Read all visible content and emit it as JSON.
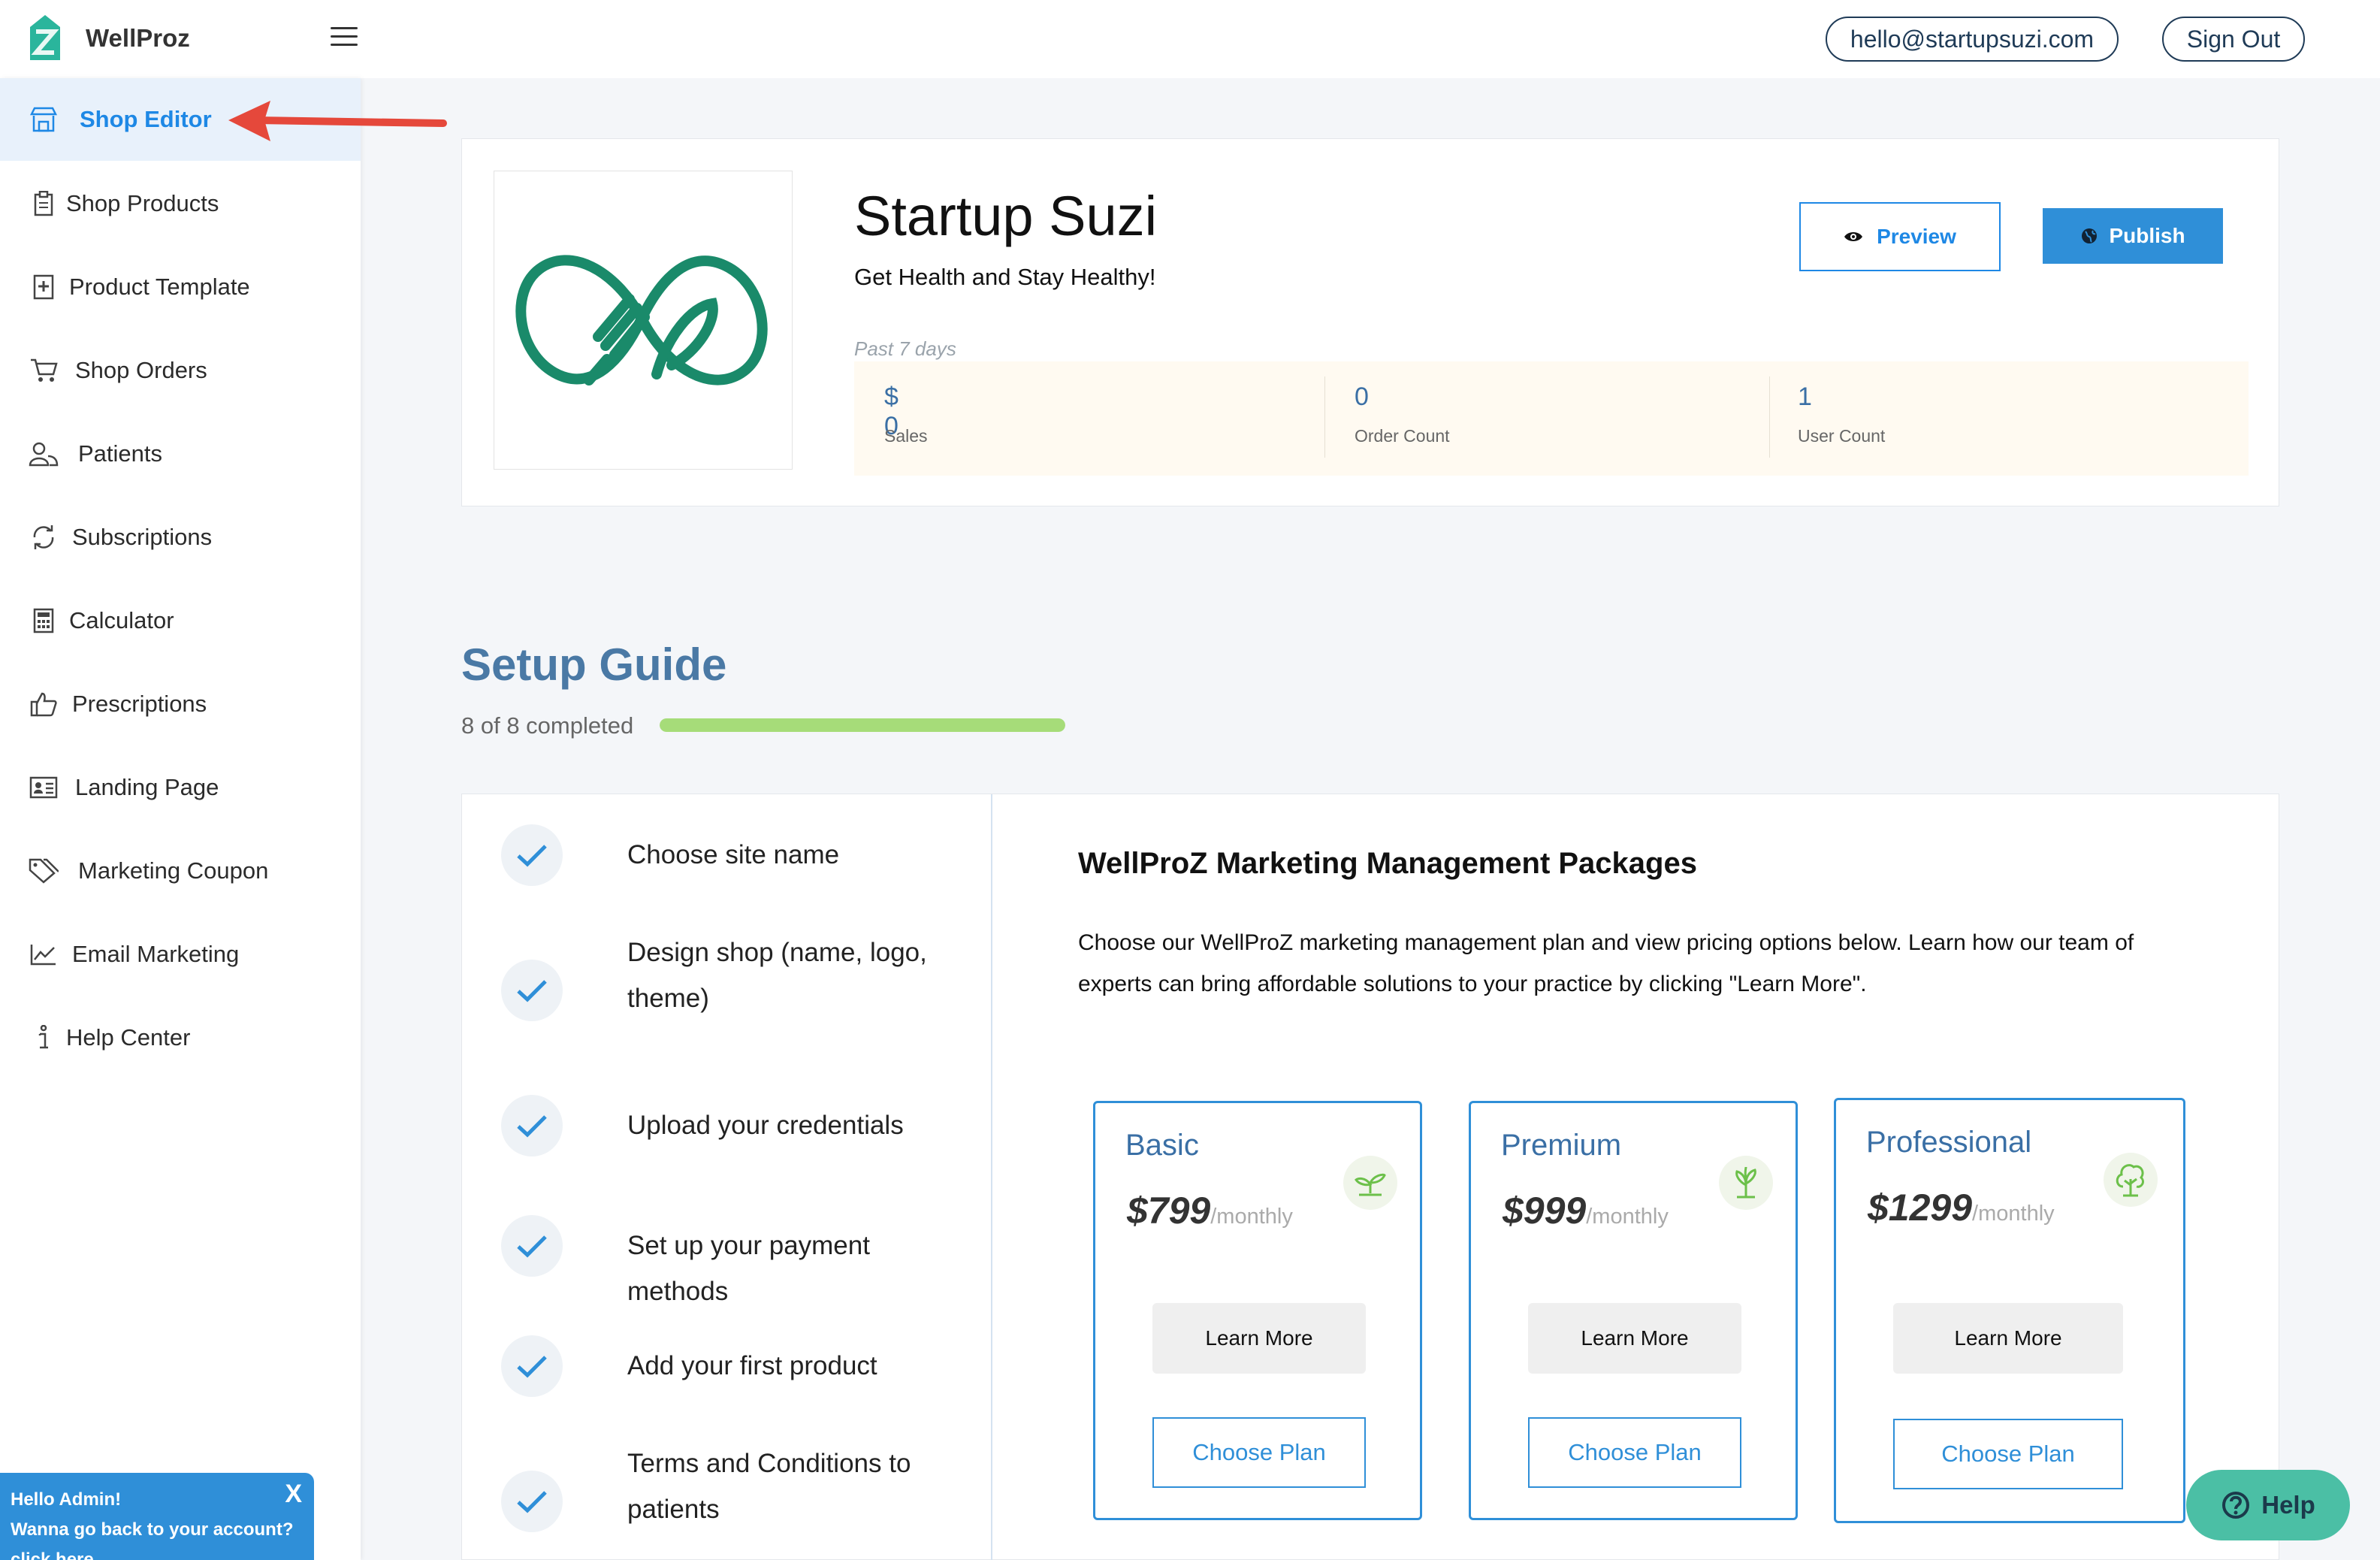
{
  "brand": {
    "name": "WellProz"
  },
  "header": {
    "email": "hello@startupsuzi.com",
    "sign_out": "Sign Out"
  },
  "sidebar": {
    "items": [
      {
        "label": "Shop Editor",
        "icon": "store-icon",
        "active": true
      },
      {
        "label": "Shop Products",
        "icon": "clipboard-icon"
      },
      {
        "label": "Product Template",
        "icon": "add-document-icon"
      },
      {
        "label": "Shop Orders",
        "icon": "cart-icon"
      },
      {
        "label": "Patients",
        "icon": "users-icon"
      },
      {
        "label": "Subscriptions",
        "icon": "refresh-icon"
      },
      {
        "label": "Calculator",
        "icon": "calculator-icon"
      },
      {
        "label": "Prescriptions",
        "icon": "thumbs-up-icon"
      },
      {
        "label": "Landing Page",
        "icon": "id-card-icon"
      },
      {
        "label": "Marketing Coupon",
        "icon": "tags-icon"
      },
      {
        "label": "Email Marketing",
        "icon": "line-chart-icon"
      },
      {
        "label": "Help Center",
        "icon": "info-icon"
      }
    ]
  },
  "admin_notice": {
    "line1": "Hello Admin!",
    "line2": "Wanna go back to your account?",
    "line3": "click here",
    "close": "X"
  },
  "shop": {
    "name": "Startup Suzi",
    "tagline": "Get Health and Stay Healthy!",
    "preview_label": "Preview",
    "publish_label": "Publish",
    "period": "Past 7 days",
    "stats": [
      {
        "value": "$ 0",
        "label": "Sales"
      },
      {
        "value": "0",
        "label": "Order Count"
      },
      {
        "value": "1",
        "label": "User Count"
      }
    ]
  },
  "setup": {
    "title": "Setup Guide",
    "progress_text": "8 of 8 completed",
    "progress_fraction": 1.0,
    "steps": [
      {
        "line1": "Choose site name",
        "line2": ""
      },
      {
        "line1": "Design shop (name, logo,",
        "line2": "theme)"
      },
      {
        "line1": "Upload your credentials",
        "line2": ""
      },
      {
        "line1": "Set up your payment methods",
        "line2": ""
      },
      {
        "line1": "Add your first product",
        "line2": ""
      },
      {
        "line1": "Terms and Conditions to",
        "line2": "patients"
      }
    ]
  },
  "packages": {
    "title": "WellProZ Marketing Management Packages",
    "description": "Choose our WellProZ marketing management plan and view pricing options below. Learn how our team of experts can bring affordable solutions to your practice by clicking \"Learn More\".",
    "plans": [
      {
        "name": "Basic",
        "price": "$799",
        "period": "/monthly",
        "icon": "sprout-icon",
        "learn_more": "Learn More",
        "choose": "Choose Plan"
      },
      {
        "name": "Premium",
        "price": "$999",
        "period": "/monthly",
        "icon": "plant-icon",
        "learn_more": "Learn More",
        "choose": "Choose Plan"
      },
      {
        "name": "Professional",
        "price": "$1299",
        "period": "/monthly",
        "icon": "tree-icon",
        "learn_more": "Learn More",
        "choose": "Choose Plan"
      }
    ]
  },
  "help_button": {
    "label": "Help"
  },
  "colors": {
    "accent": "#2f8fd8",
    "title_blue": "#4a79a5",
    "progress_green": "#a6dc79",
    "logo_green": "#1a8a6a",
    "help_teal": "#4bbfa5",
    "arrow_red": "#e5483b"
  }
}
